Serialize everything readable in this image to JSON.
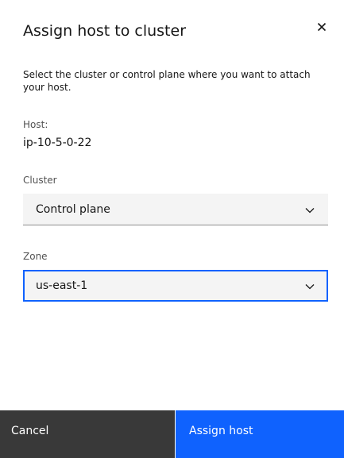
{
  "modal": {
    "title": "Assign host to cluster",
    "description": "Select the cluster or control plane where you want to attach your host.",
    "close_icon": "close-icon"
  },
  "host": {
    "label": "Host:",
    "value": "ip-10-5-0-22"
  },
  "cluster": {
    "label": "Cluster",
    "selected": "Control plane",
    "icon": "chevron-down-icon"
  },
  "zone": {
    "label": "Zone",
    "selected": "us-east-1",
    "icon": "chevron-down-icon",
    "focused": true
  },
  "footer": {
    "cancel_label": "Cancel",
    "primary_label": "Assign host"
  },
  "colors": {
    "primary": "#0f62fe",
    "secondary": "#393939",
    "field_bg": "#f4f4f4",
    "text": "#161616",
    "label": "#525252"
  }
}
